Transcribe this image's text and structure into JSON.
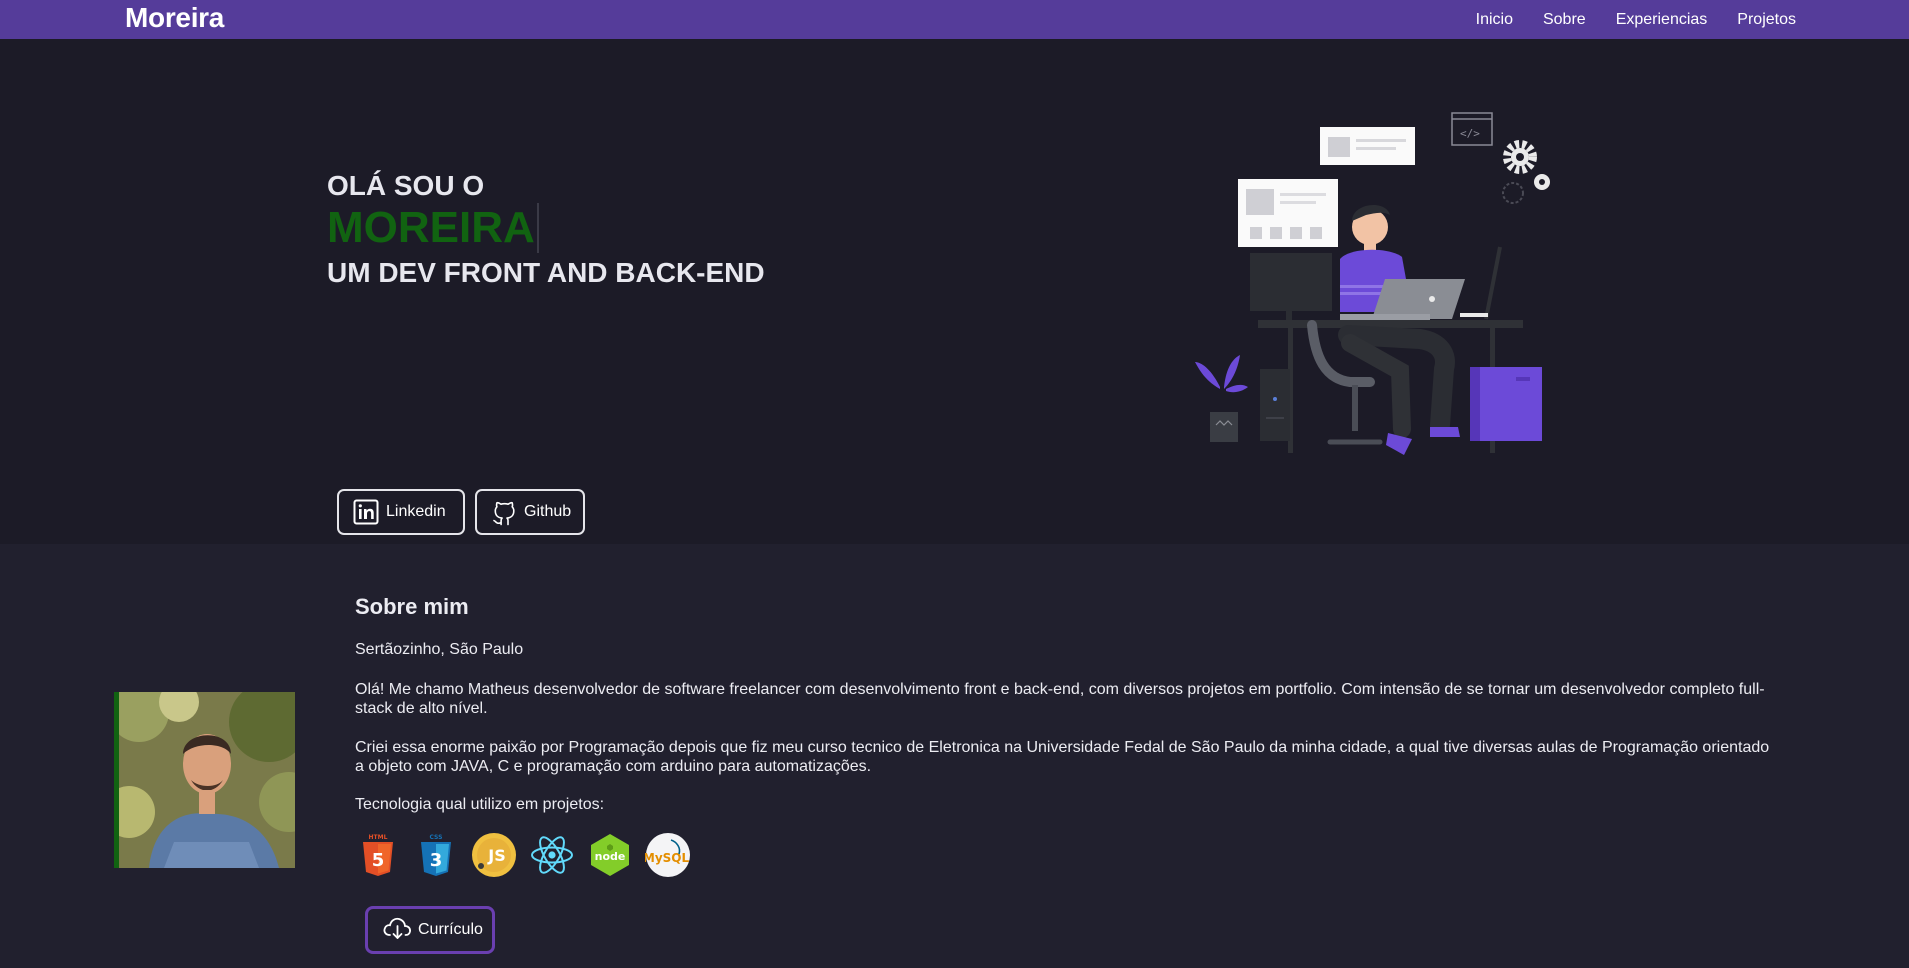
{
  "nav": {
    "brand": "Moreira",
    "links": [
      "Inicio",
      "Sobre",
      "Experiencias",
      "Projetos"
    ]
  },
  "hero": {
    "greeting": "OLÁ SOU O",
    "name": "MOREIRA",
    "role": "UM DEV FRONT AND BACK-END",
    "buttons": {
      "linkedin": "Linkedin",
      "github": "Github"
    }
  },
  "about": {
    "title": "Sobre mim",
    "location": "Sertãozinho, São Paulo",
    "paragraph1": "Olá! Me chamo Matheus desenvolvedor de software freelancer com desenvolvimento front e back-end, com diversos projetos em portfolio. Com intensão de se tornar um desenvolvedor completo full-stack de alto nível.",
    "paragraph2": "Criei essa enorme paixão por Programação depois que fiz meu curso tecnico de Eletronica na Universidade Fedal de São Paulo da minha cidade, a qual tive diversas aulas de Programação orientado a objeto com JAVA, C e programação com arduino para automatizações.",
    "tech_label": "Tecnologia qual utilizo em projetos:",
    "tech_icons": {
      "html": {
        "icon": "html5-icon",
        "caption": "HTML",
        "text": "5"
      },
      "css": {
        "icon": "css3-icon",
        "caption": "CSS",
        "text": "3"
      },
      "js": {
        "icon": "javascript-icon",
        "text": "JS"
      },
      "react": {
        "icon": "react-icon"
      },
      "node": {
        "icon": "nodejs-icon",
        "text": "node"
      },
      "mysql": {
        "icon": "mysql-icon",
        "text": "MySQL"
      }
    },
    "cv_button": "Currículo"
  },
  "colors": {
    "navbar": "#553c9a",
    "hero_bg": "#1c1b27",
    "section_bg": "#21202e",
    "name_accent": "#116311",
    "cv_border": "#6a3fb0"
  }
}
